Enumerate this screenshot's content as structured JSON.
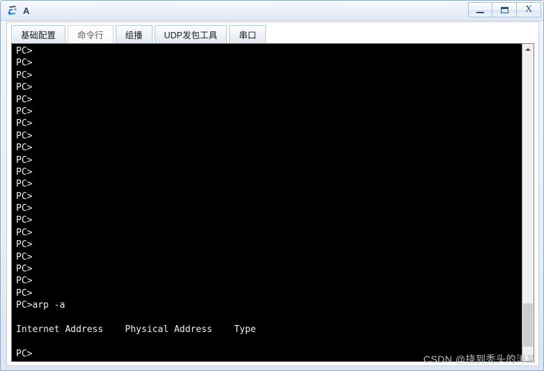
{
  "window": {
    "title": "A",
    "icon": "network-device-icon",
    "controls": [
      {
        "name": "minimize-button",
        "label": "—"
      },
      {
        "name": "maximize-button",
        "label": "❐"
      },
      {
        "name": "close-button",
        "label": "X"
      }
    ]
  },
  "tabs": [
    {
      "label": "基础配置",
      "name": "tab-basic-config",
      "active": false
    },
    {
      "label": "命令行",
      "name": "tab-command-line",
      "active": true
    },
    {
      "label": "组播",
      "name": "tab-multicast",
      "active": false
    },
    {
      "label": "UDP发包工具",
      "name": "tab-udp-packet-tool",
      "active": false
    },
    {
      "label": "串口",
      "name": "tab-serial-port",
      "active": false
    }
  ],
  "terminal": {
    "prompt": "PC>",
    "lines": [
      "PC>",
      "PC>",
      "PC>",
      "PC>",
      "PC>",
      "PC>",
      "PC>",
      "PC>",
      "PC>",
      "PC>",
      "PC>",
      "PC>",
      "PC>",
      "PC>",
      "PC>",
      "PC>",
      "PC>",
      "PC>",
      "PC>",
      "PC>",
      "PC>",
      "PC>arp -a",
      "",
      "Internet Address    Physical Address    Type",
      "",
      "PC>"
    ],
    "command": "arp -a",
    "table_header": "Internet Address    Physical Address    Type",
    "colors": {
      "background": "#000000",
      "text": "#f0f0f0"
    }
  },
  "scrollbar": {
    "name": "terminal-scrollbar",
    "up_arrow": "scroll-up-arrow",
    "down_arrow": "scroll-down-arrow",
    "thumb_position": "bottom"
  },
  "watermark": {
    "text": "CSDN @挠到秃头的涛某"
  }
}
